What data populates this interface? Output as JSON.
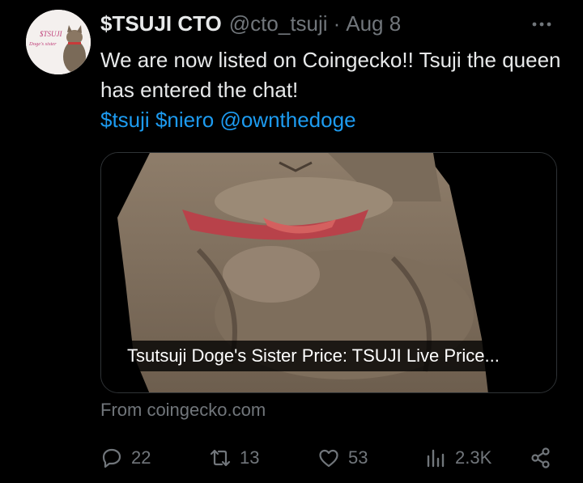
{
  "tweet": {
    "display_name": "$TSUJI CTO",
    "handle": "@cto_tsuji",
    "separator": "·",
    "date": "Aug 8",
    "text": "We are now listed on Coingecko!! Tsuji the queen has entered the chat!",
    "hashtags": [
      "$tsuji",
      "$niero",
      "@ownthedoge"
    ],
    "avatar": {
      "line1": "$TSUJI",
      "line2": "Doge's sister"
    }
  },
  "card": {
    "title": "Tsutsuji Doge's Sister Price: TSUJI Live Price...",
    "source": "From coingecko.com"
  },
  "actions": {
    "replies": "22",
    "reposts": "13",
    "likes": "53",
    "views": "2.3K"
  },
  "icons": {
    "more": "more-icon",
    "reply": "reply-icon",
    "repost": "repost-icon",
    "like": "heart-icon",
    "views": "views-icon",
    "share": "share-icon"
  },
  "colors": {
    "background": "#000000",
    "primary_text": "#e7e9ea",
    "secondary_text": "#71767b",
    "link": "#1d9bf0",
    "border": "#2f3336"
  }
}
